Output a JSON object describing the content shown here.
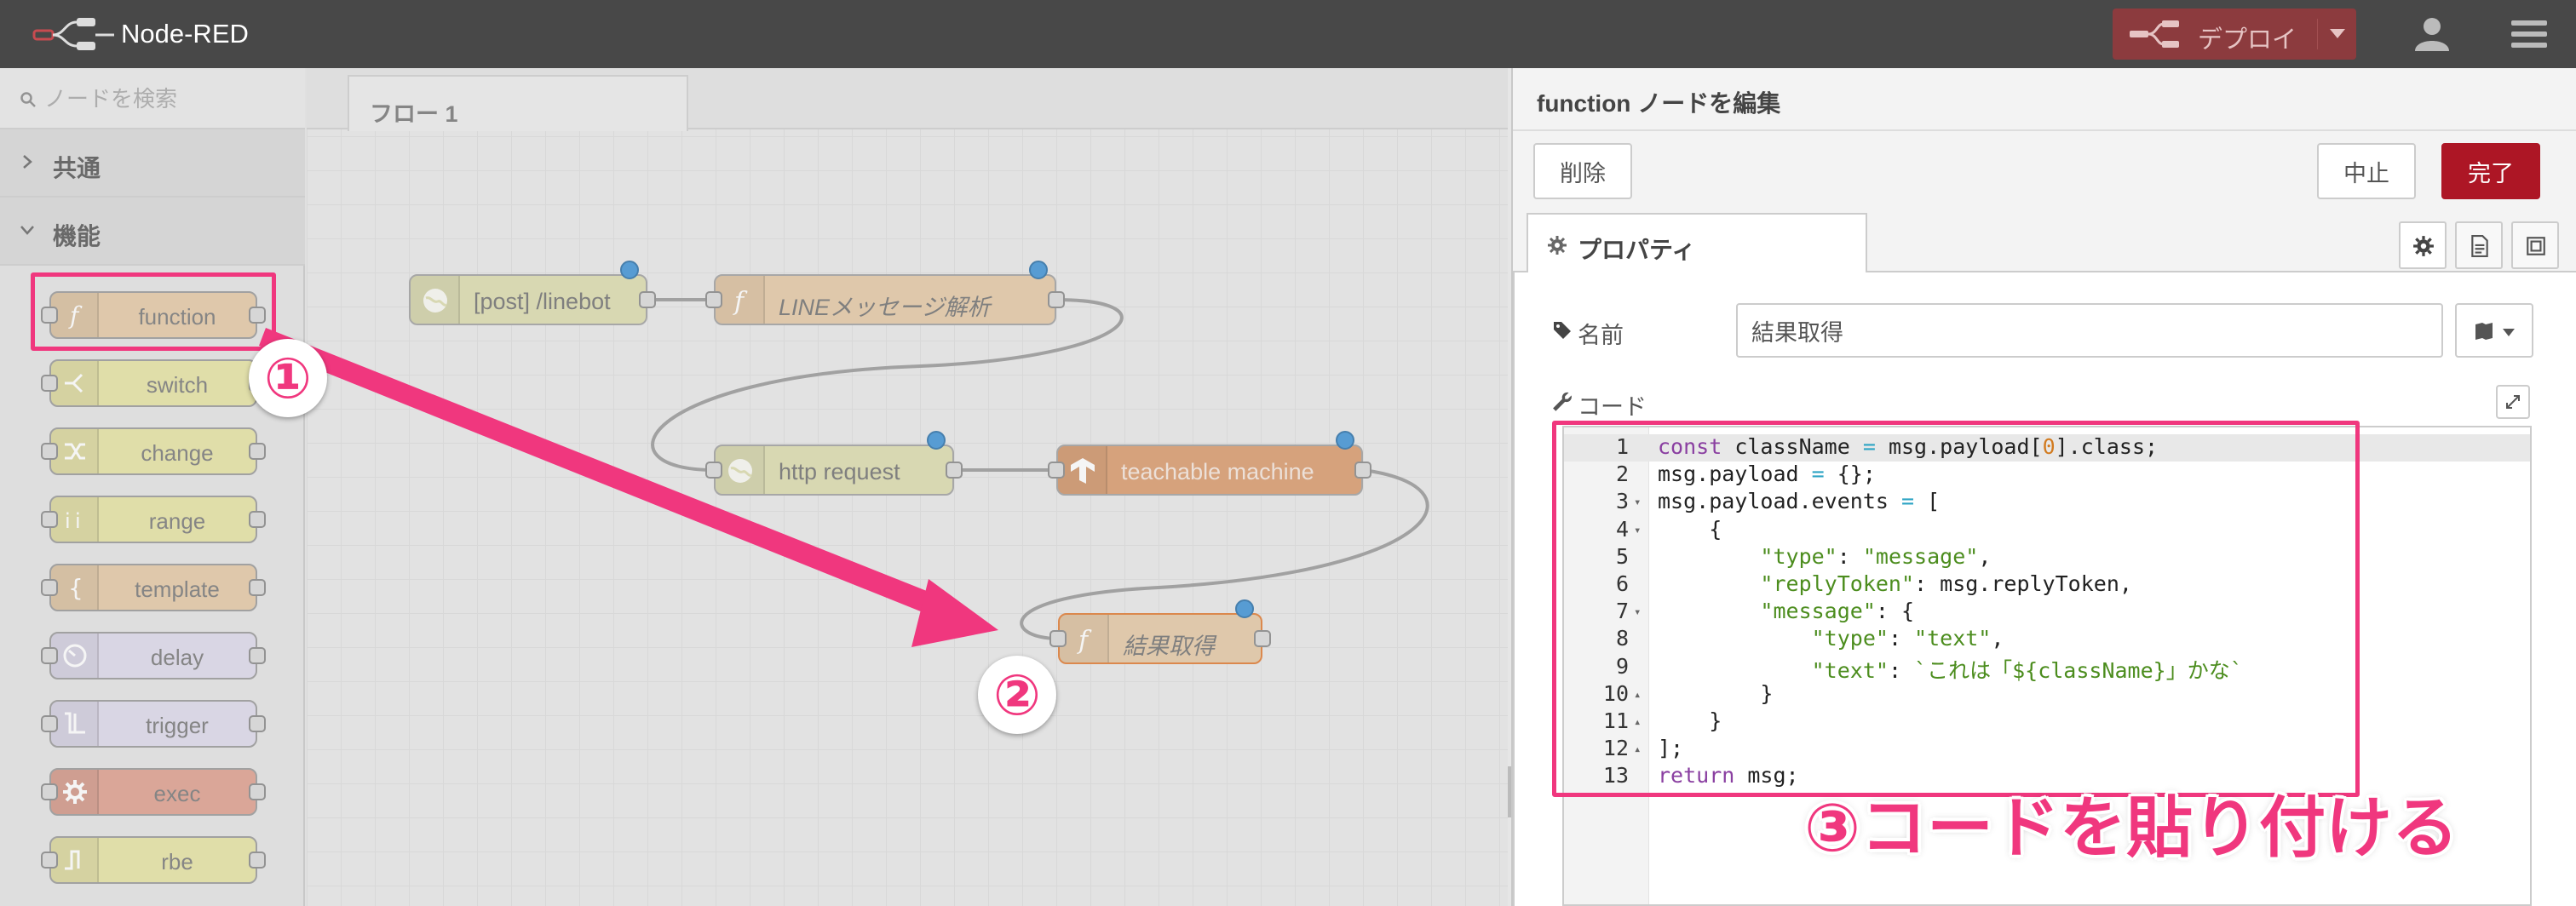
{
  "app": {
    "title": "Node-RED",
    "deploy_label": "デプロイ"
  },
  "palette": {
    "search_placeholder": "ノードを検索",
    "categories": [
      {
        "label": "共通",
        "expanded": false
      },
      {
        "label": "機能",
        "expanded": true
      }
    ],
    "nodes": [
      {
        "label": "function",
        "color": "#e5c9a5",
        "icon": "function-icon"
      },
      {
        "label": "switch",
        "color": "#e6e3a3",
        "icon": "switch-icon"
      },
      {
        "label": "change",
        "color": "#e6e3a3",
        "icon": "change-icon"
      },
      {
        "label": "range",
        "color": "#e6e3a3",
        "icon": "range-icon"
      },
      {
        "label": "template",
        "color": "#e5c9a5",
        "icon": "template-icon"
      },
      {
        "label": "delay",
        "color": "#ddd9eb",
        "icon": "delay-icon"
      },
      {
        "label": "trigger",
        "color": "#ddd9eb",
        "icon": "trigger-icon"
      },
      {
        "label": "exec",
        "color": "#df9f8e",
        "icon": "exec-icon"
      },
      {
        "label": "rbe",
        "color": "#e6e3a3",
        "icon": "rbe-icon"
      }
    ]
  },
  "workspace": {
    "tab_label": "フロー 1",
    "nodes": [
      {
        "label": "[post] /linebot",
        "color": "#dcdcae",
        "italic": false
      },
      {
        "label": "LINEメッセージ解析",
        "color": "#e5c9a5",
        "italic": true
      },
      {
        "label": "http request",
        "color": "#dcdcae",
        "italic": false
      },
      {
        "label": "teachable machine",
        "color": "#d99a6c",
        "italic": false
      },
      {
        "label": "結果取得",
        "color": "#e5c9a5",
        "italic": true
      }
    ]
  },
  "editor": {
    "title": "function ノードを編集",
    "delete_label": "削除",
    "cancel_label": "中止",
    "done_label": "完了",
    "properties_tab": "プロパティ",
    "name_label": "名前",
    "name_value": "結果取得",
    "code_label": "コード",
    "code_lines": [
      "const className = msg.payload[0].class;",
      "msg.payload = {};",
      "msg.payload.events = [",
      "    {",
      "        \"type\": \"message\",",
      "        \"replyToken\": msg.replyToken,",
      "        \"message\": {",
      "            \"type\": \"text\",",
      "            \"text\": `これは「${className}」かな`",
      "        }",
      "    }",
      "];",
      "return msg;"
    ]
  },
  "annotations": {
    "step1": "①",
    "step2": "②",
    "step3": "③コードを貼り付ける",
    "accent_color": "#f0377e"
  }
}
